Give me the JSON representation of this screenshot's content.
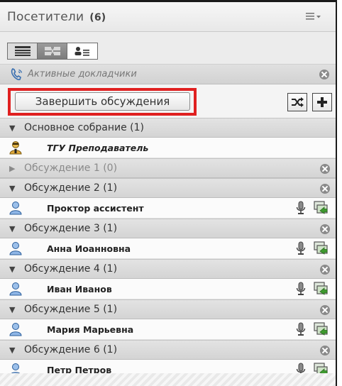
{
  "header": {
    "title": "Посетители",
    "count": "(6)"
  },
  "active_speakers": {
    "label": "Активные докладчики"
  },
  "actions": {
    "end_breakouts_label": "Завершить обсуждения"
  },
  "main_room": {
    "label": "Основное собрание (1)",
    "host": "ТГУ Преподаватель"
  },
  "breakouts": [
    {
      "label": "Обсуждение 1 (0)",
      "expanded": false,
      "user": ""
    },
    {
      "label": "Обсуждение 2 (1)",
      "expanded": true,
      "user": "Проктор ассистент"
    },
    {
      "label": "Обсуждение 3 (1)",
      "expanded": true,
      "user": "Анна Иоанновна"
    },
    {
      "label": "Обсуждение 4 (1)",
      "expanded": true,
      "user": "Иван Иванов"
    },
    {
      "label": "Обсуждение 5 (1)",
      "expanded": true,
      "user": "Мария Марьевна"
    },
    {
      "label": "Обсуждение 6 (1)",
      "expanded": true,
      "user": "Петр Петров"
    }
  ],
  "icons": {
    "menu": "hamburger-menu-icon",
    "views": [
      "list-view-icon",
      "breakout-view-icon",
      "attendee-status-icon"
    ],
    "close": "close-circle-icon",
    "shuffle": "shuffle-icon",
    "add": "plus-icon",
    "user": "user-icon",
    "host": "host-user-icon",
    "mic": "microphone-icon",
    "share": "screen-share-icon"
  },
  "colors": {
    "highlight": "#e02020",
    "accent": "#3a6fb0"
  }
}
